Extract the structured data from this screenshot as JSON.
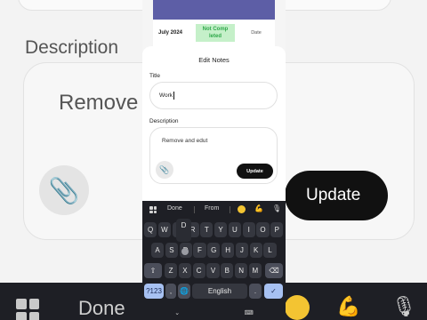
{
  "background": {
    "description_label": "Description",
    "description_preview": "Remove",
    "update_button": "Update",
    "keyboard_done": "Done"
  },
  "table": {
    "row": {
      "date": "July 2024",
      "status": "Not Comp leted",
      "date_col": "Date"
    }
  },
  "dialog": {
    "title": "Edit Notes",
    "title_label": "Title",
    "title_value": "Work",
    "description_label": "Description",
    "description_value": "Remove and edut",
    "update_button": "Update"
  },
  "keyboard": {
    "suggestions": [
      "Done",
      "From"
    ],
    "row1": [
      "Q",
      "W",
      "E",
      "R",
      "T",
      "Y",
      "U",
      "I",
      "O",
      "P"
    ],
    "row2": [
      "A",
      "S",
      "D",
      "F",
      "G",
      "H",
      "J",
      "K",
      "L"
    ],
    "row3": [
      "Z",
      "X",
      "C",
      "V",
      "B",
      "N",
      "M"
    ],
    "popup_key": "D",
    "symbols_key": "?123",
    "comma_key": ",",
    "space_label": "English",
    "period_key": ".",
    "nav_down": "⌄",
    "nav_keyboard": "⌨"
  },
  "colors": {
    "accent_key": "#a7c1f2",
    "table_header": "#5d5ea6",
    "status_green": "#2fa84a"
  }
}
